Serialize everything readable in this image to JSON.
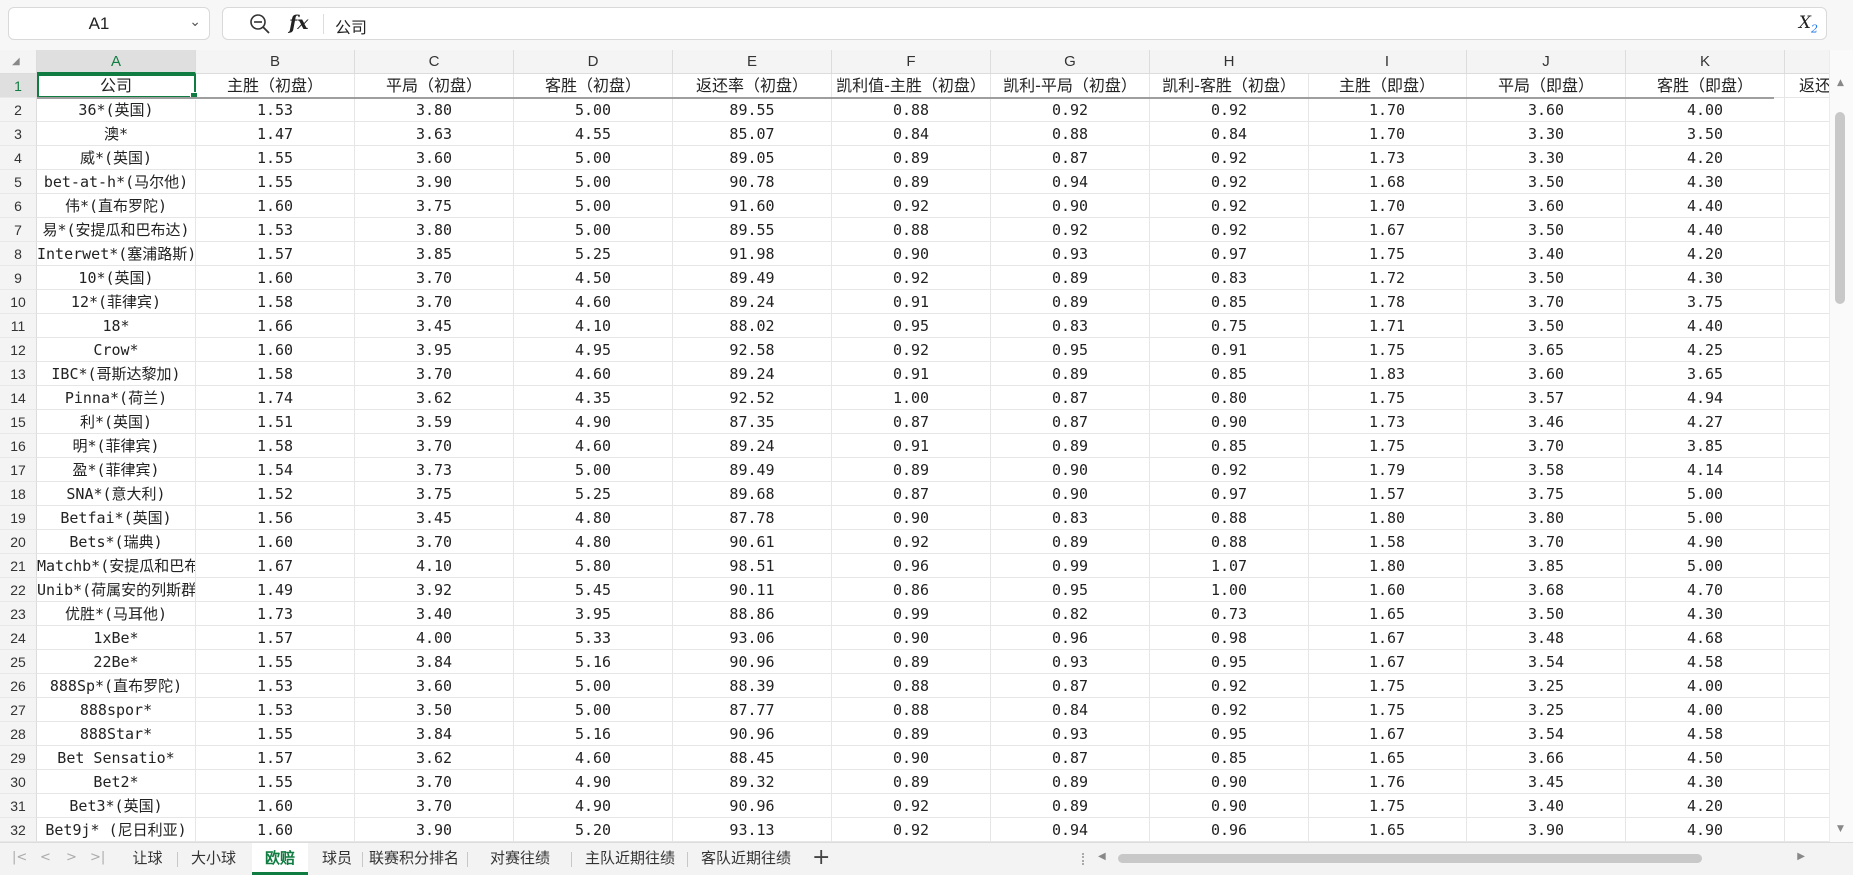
{
  "formula_bar": {
    "name_box": "A1",
    "content": "公司"
  },
  "columns": [
    "A",
    "B",
    "C",
    "D",
    "E",
    "F",
    "G",
    "H",
    "I",
    "J",
    "K"
  ],
  "selected_cell": {
    "col": "A",
    "row": 1
  },
  "header_row": [
    "公司",
    "主胜（初盘）",
    "平局（初盘）",
    "客胜（初盘）",
    "返还率（初盘）",
    "凯利值-主胜（初盘）",
    "凯利-平局（初盘）",
    "凯利-客胜（初盘）",
    "主胜（即盘）",
    "平局（即盘）",
    "客胜（即盘）",
    "返还"
  ],
  "rows": [
    [
      "36*(英国)",
      "1.53",
      "3.80",
      "5.00",
      "89.55",
      "0.88",
      "0.92",
      "0.92",
      "1.70",
      "3.60",
      "4.00"
    ],
    [
      "澳*",
      "1.47",
      "3.63",
      "4.55",
      "85.07",
      "0.84",
      "0.88",
      "0.84",
      "1.70",
      "3.30",
      "3.50"
    ],
    [
      "威*(英国)",
      "1.55",
      "3.60",
      "5.00",
      "89.05",
      "0.89",
      "0.87",
      "0.92",
      "1.73",
      "3.30",
      "4.20"
    ],
    [
      "bet-at-h*(马尔他)",
      "1.55",
      "3.90",
      "5.00",
      "90.78",
      "0.89",
      "0.94",
      "0.92",
      "1.68",
      "3.50",
      "4.30"
    ],
    [
      "伟*(直布罗陀)",
      "1.60",
      "3.75",
      "5.00",
      "91.60",
      "0.92",
      "0.90",
      "0.92",
      "1.70",
      "3.60",
      "4.40"
    ],
    [
      "易*(安提瓜和巴布达)",
      "1.53",
      "3.80",
      "5.00",
      "89.55",
      "0.88",
      "0.92",
      "0.92",
      "1.67",
      "3.50",
      "4.40"
    ],
    [
      "Interwet*(塞浦路斯)",
      "1.57",
      "3.85",
      "5.25",
      "91.98",
      "0.90",
      "0.93",
      "0.97",
      "1.75",
      "3.40",
      "4.20"
    ],
    [
      "10*(英国)",
      "1.60",
      "3.70",
      "4.50",
      "89.49",
      "0.92",
      "0.89",
      "0.83",
      "1.72",
      "3.50",
      "4.30"
    ],
    [
      "12*(菲律宾)",
      "1.58",
      "3.70",
      "4.60",
      "89.24",
      "0.91",
      "0.89",
      "0.85",
      "1.78",
      "3.70",
      "3.75"
    ],
    [
      "18*",
      "1.66",
      "3.45",
      "4.10",
      "88.02",
      "0.95",
      "0.83",
      "0.75",
      "1.71",
      "3.50",
      "4.40"
    ],
    [
      "Crow*",
      "1.60",
      "3.95",
      "4.95",
      "92.58",
      "0.92",
      "0.95",
      "0.91",
      "1.75",
      "3.65",
      "4.25"
    ],
    [
      "IBC*(哥斯达黎加)",
      "1.58",
      "3.70",
      "4.60",
      "89.24",
      "0.91",
      "0.89",
      "0.85",
      "1.83",
      "3.60",
      "3.65"
    ],
    [
      "Pinna*(荷兰)",
      "1.74",
      "3.62",
      "4.35",
      "92.52",
      "1.00",
      "0.87",
      "0.80",
      "1.75",
      "3.57",
      "4.94"
    ],
    [
      "利*(英国)",
      "1.51",
      "3.59",
      "4.90",
      "87.35",
      "0.87",
      "0.87",
      "0.90",
      "1.73",
      "3.46",
      "4.27"
    ],
    [
      "明*(菲律宾)",
      "1.58",
      "3.70",
      "4.60",
      "89.24",
      "0.91",
      "0.89",
      "0.85",
      "1.75",
      "3.70",
      "3.85"
    ],
    [
      "盈*(菲律宾)",
      "1.54",
      "3.73",
      "5.00",
      "89.49",
      "0.89",
      "0.90",
      "0.92",
      "1.79",
      "3.58",
      "4.14"
    ],
    [
      "SNA*(意大利)",
      "1.52",
      "3.75",
      "5.25",
      "89.68",
      "0.87",
      "0.90",
      "0.97",
      "1.57",
      "3.75",
      "5.00"
    ],
    [
      "Betfai*(英国)",
      "1.56",
      "3.45",
      "4.80",
      "87.78",
      "0.90",
      "0.83",
      "0.88",
      "1.80",
      "3.80",
      "5.00"
    ],
    [
      "Bets*(瑞典)",
      "1.60",
      "3.70",
      "4.80",
      "90.61",
      "0.92",
      "0.89",
      "0.88",
      "1.58",
      "3.70",
      "4.90"
    ],
    [
      "Matchb*(安提瓜和巴布达)",
      "1.67",
      "4.10",
      "5.80",
      "98.51",
      "0.96",
      "0.99",
      "1.07",
      "1.80",
      "3.85",
      "5.00"
    ],
    [
      "Unib*(荷属安的列斯群岛)",
      "1.49",
      "3.92",
      "5.45",
      "90.11",
      "0.86",
      "0.95",
      "1.00",
      "1.60",
      "3.68",
      "4.70"
    ],
    [
      "优胜*(马耳他)",
      "1.73",
      "3.40",
      "3.95",
      "88.86",
      "0.99",
      "0.82",
      "0.73",
      "1.65",
      "3.50",
      "4.30"
    ],
    [
      "1xBe*",
      "1.57",
      "4.00",
      "5.33",
      "93.06",
      "0.90",
      "0.96",
      "0.98",
      "1.67",
      "3.48",
      "4.68"
    ],
    [
      "22Be*",
      "1.55",
      "3.84",
      "5.16",
      "90.96",
      "0.89",
      "0.93",
      "0.95",
      "1.67",
      "3.54",
      "4.58"
    ],
    [
      "888Sp*(直布罗陀)",
      "1.53",
      "3.60",
      "5.00",
      "88.39",
      "0.88",
      "0.87",
      "0.92",
      "1.75",
      "3.25",
      "4.00"
    ],
    [
      "888spor*",
      "1.53",
      "3.50",
      "5.00",
      "87.77",
      "0.88",
      "0.84",
      "0.92",
      "1.75",
      "3.25",
      "4.00"
    ],
    [
      "888Star*",
      "1.55",
      "3.84",
      "5.16",
      "90.96",
      "0.89",
      "0.93",
      "0.95",
      "1.67",
      "3.54",
      "4.58"
    ],
    [
      "Bet Sensatio*",
      "1.57",
      "3.62",
      "4.60",
      "88.45",
      "0.90",
      "0.87",
      "0.85",
      "1.65",
      "3.66",
      "4.50"
    ],
    [
      "Bet2*",
      "1.55",
      "3.70",
      "4.90",
      "89.32",
      "0.89",
      "0.89",
      "0.90",
      "1.76",
      "3.45",
      "4.30"
    ],
    [
      "Bet3*(英国)",
      "1.60",
      "3.70",
      "4.90",
      "90.96",
      "0.92",
      "0.89",
      "0.90",
      "1.75",
      "3.40",
      "4.20"
    ],
    [
      "Bet9j* (尼日利亚)",
      "1.60",
      "3.90",
      "5.20",
      "93.13",
      "0.92",
      "0.94",
      "0.96",
      "1.65",
      "3.90",
      "4.90"
    ]
  ],
  "sheet_tabs": [
    "让球",
    "大小球",
    "欧赔",
    "球员",
    "联赛积分排名",
    "对赛往绩",
    "主队近期往绩",
    "客队近期往绩"
  ],
  "active_tab": "欧赔",
  "icons": {
    "zoom": "zoom-out-icon",
    "function": "fx-icon",
    "clear": "clear-format-icon",
    "add_sheet": "plus-icon"
  },
  "colors": {
    "accent": "#107c41",
    "gridline": "#e6e6e6",
    "header_bg": "#f4f4f4"
  }
}
